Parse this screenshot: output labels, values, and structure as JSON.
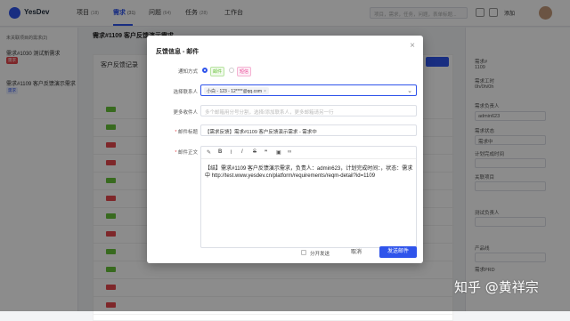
{
  "app": {
    "name": "YesDev"
  },
  "nav": [
    {
      "label": "项目",
      "count": "(18)"
    },
    {
      "label": "需求",
      "count": "(31)"
    },
    {
      "label": "问题",
      "count": "(64)"
    },
    {
      "label": "任务",
      "count": "(28)"
    },
    {
      "label": "工作台",
      "count": ""
    }
  ],
  "search_placeholder": "项目，需求，任务，问题，表单标题...",
  "add_user_label": "添加",
  "sidebar": {
    "head": "未关联项目的需求(2)",
    "items": [
      {
        "label": "需求#1030 测试新需求",
        "tag": "需求"
      },
      {
        "label": "需求#1109 客户反馈演示需求",
        "tag": "需求"
      }
    ]
  },
  "main": {
    "title": "需求#1109 客户反馈演示需求",
    "panel_title": "客户反馈记录"
  },
  "right": {
    "labels": [
      "需求#",
      "1109",
      "需求工时",
      "0h/0h/0h",
      "需求负责人",
      "admin623",
      "需求状态",
      "需求中",
      "计划完成时间",
      "关联项目",
      "测试负责人",
      "产品线",
      "需求PRD"
    ],
    "assignee": "admin623",
    "status": "需求中"
  },
  "modal": {
    "title": "反馈信息 - 邮件",
    "close_icon": "close-icon",
    "fields": {
      "notify_label": "通知方式",
      "notify_options": [
        "邮件",
        "短信"
      ],
      "contact_label": "选择联系人",
      "contact_chip": "小白 - 123 - 12****@qq.com",
      "cc_label": "更多收件人",
      "cc_placeholder": "多个邮箱用分号分割，选择/添加联系人，更多邮箱请另一行",
      "subject_label": "邮件标题",
      "subject_value": "【需求反馈】需求#1109 客户反馈演示需求 - 需求中",
      "body_label": "邮件正文",
      "body_text": "【结】需求#1109 客户反馈演示需求，负责人：admin623，计划完成时间：，状态：需求中 http://test.www.yesdev.cn/platform/requirements/reqm-detail?id=1109"
    },
    "separate_send_label": "分开发送",
    "cancel_label": "取消",
    "send_label": "发送邮件"
  },
  "watermark": "知乎 @黄祥宗",
  "colors": {
    "accent": "#2f54eb",
    "danger": "#e5484d",
    "success": "#67c23a"
  }
}
